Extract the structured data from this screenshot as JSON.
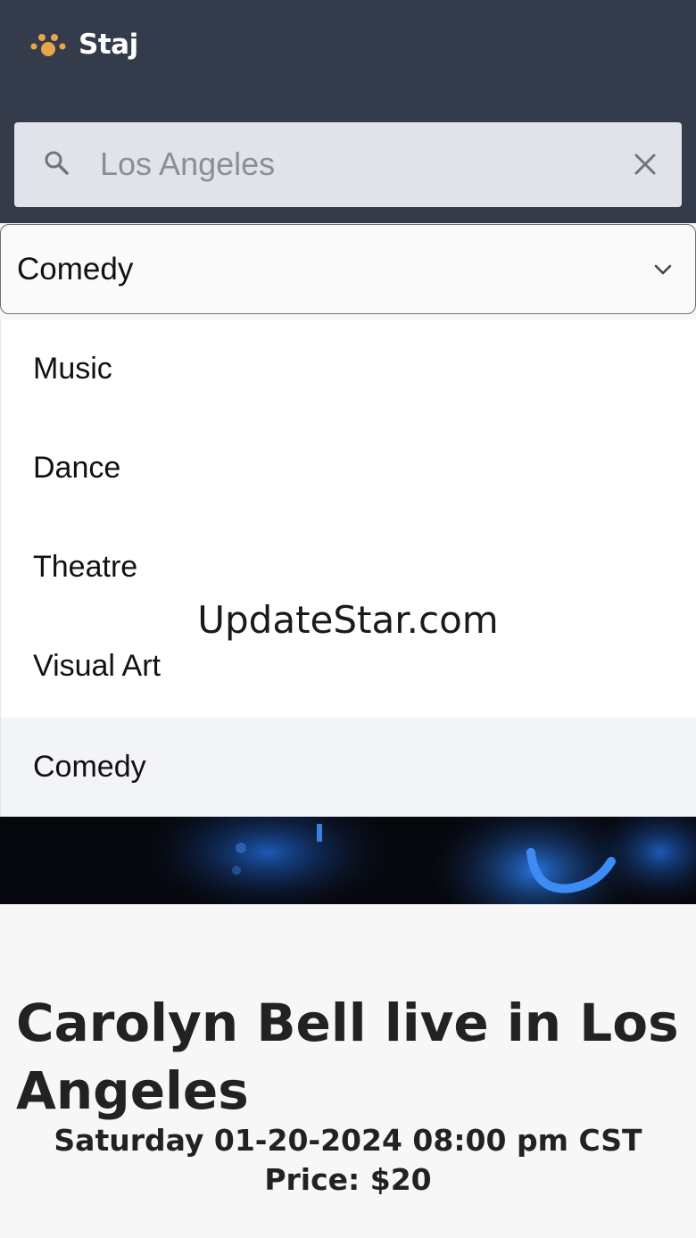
{
  "app": {
    "name": "Staj"
  },
  "colors": {
    "header_bg": "#343b4a",
    "logo_gold": "#e8a64a",
    "selected_option_bg": "#f3f4f7"
  },
  "search": {
    "value": "Los Angeles",
    "placeholder": "Los Angeles",
    "icon": "search-icon",
    "clear_icon": "close-icon"
  },
  "category_select": {
    "selected": "Comedy",
    "icon": "chevron-down-icon",
    "options": [
      "Music",
      "Dance",
      "Theatre",
      "Visual Art",
      "Comedy"
    ]
  },
  "watermark": "UpdateStar.com",
  "event": {
    "title": "Carolyn Bell live in Los Angeles",
    "datetime": "Saturday 01-20-2024 08:00 pm CST",
    "price": "Price: $20"
  }
}
